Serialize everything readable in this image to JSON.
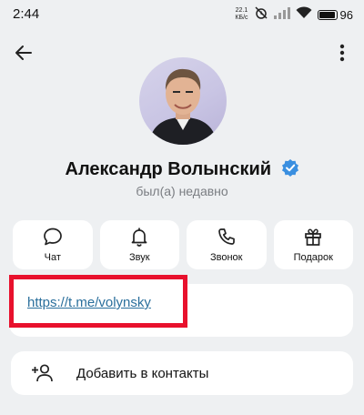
{
  "status_bar": {
    "time": "2:44",
    "net_speed_value": "22.1",
    "net_speed_unit": "КБ/с",
    "battery_percent": "96",
    "battery_level": 0.96
  },
  "header": {
    "back_icon": "arrow-left-icon",
    "more_icon": "more-vertical-icon"
  },
  "profile": {
    "name": "Александр Волынский",
    "verified_icon": "verified-badge-icon",
    "last_seen": "был(а) недавно"
  },
  "actions": [
    {
      "label": "Чат",
      "icon": "chat-bubble-icon"
    },
    {
      "label": "Звук",
      "icon": "bell-icon"
    },
    {
      "label": "Звонок",
      "icon": "phone-icon"
    },
    {
      "label": "Подарок",
      "icon": "gift-icon"
    }
  ],
  "link": {
    "url": "https://t.me/volynsky"
  },
  "add_contact": {
    "label": "Добавить в контакты",
    "icon": "add-person-icon"
  },
  "colors": {
    "background": "#eef0f2",
    "card": "#ffffff",
    "accent_blue": "#3a8fe0",
    "link": "#2a6f9c",
    "highlight_red": "#e8112d"
  }
}
